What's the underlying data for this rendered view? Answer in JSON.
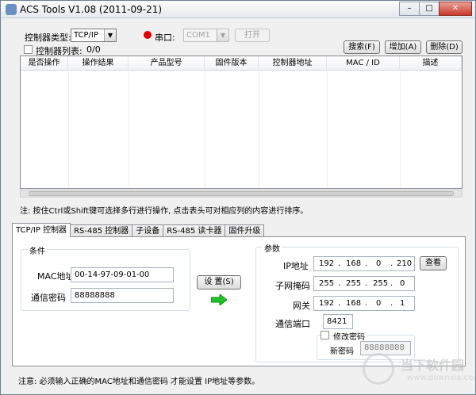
{
  "window": {
    "title": "ACS Tools V1.08 (2011-09-21)",
    "minimize": "–",
    "maximize": "□",
    "close": "✕"
  },
  "top": {
    "controller_type_label": "控制器类型:",
    "controller_type_value": "TCP/IP",
    "serial_label": "串口:",
    "serial_port_value": "COM1",
    "open_button": "打开",
    "controller_list_label": "控制器列表:",
    "controller_count": "0/0",
    "search_button": "搜索(F)",
    "add_button": "增加(A)",
    "delete_button": "删除(D)",
    "status_dot_color": "#e00000"
  },
  "table": {
    "columns": [
      "是否操作",
      "操作结果",
      "产品型号",
      "固件版本",
      "控制器地址",
      "MAC / ID",
      "描述"
    ],
    "rows": []
  },
  "hint": "注: 按住Ctrl或Shift键可选择多行进行操作, 点击表头可对相应列的内容进行排序。",
  "tabs": [
    "TCP/IP 控制器",
    "RS-485 控制器",
    "子设备",
    "RS-485 读卡器",
    "固件升级"
  ],
  "conditions": {
    "title": "条件",
    "mac_label": "MAC地址",
    "mac_value": "00-14-97-09-01-00",
    "password_label": "通信密码",
    "password_value": "88888888"
  },
  "set_button": "设 置(S)",
  "params": {
    "title": "参数",
    "ip_label": "IP地址",
    "ip": [
      "192",
      "168",
      "0",
      "210"
    ],
    "view_button": "查看",
    "mask_label": "子网掩码",
    "mask": [
      "255",
      "255",
      "255",
      "0"
    ],
    "gateway_label": "网关",
    "gateway": [
      "192",
      "168",
      "0",
      "1"
    ],
    "port_label": "通信端口",
    "port_value": "8421",
    "change_password_label": "修改密码",
    "new_password_label": "新密码",
    "new_password_value": "88888888"
  },
  "footer_note": "注意: 必须输入正确的MAC地址和通信密码 才能设置 IP地址等参数。",
  "watermark": {
    "text": "当下软件园",
    "url": "www.downxia.com"
  }
}
